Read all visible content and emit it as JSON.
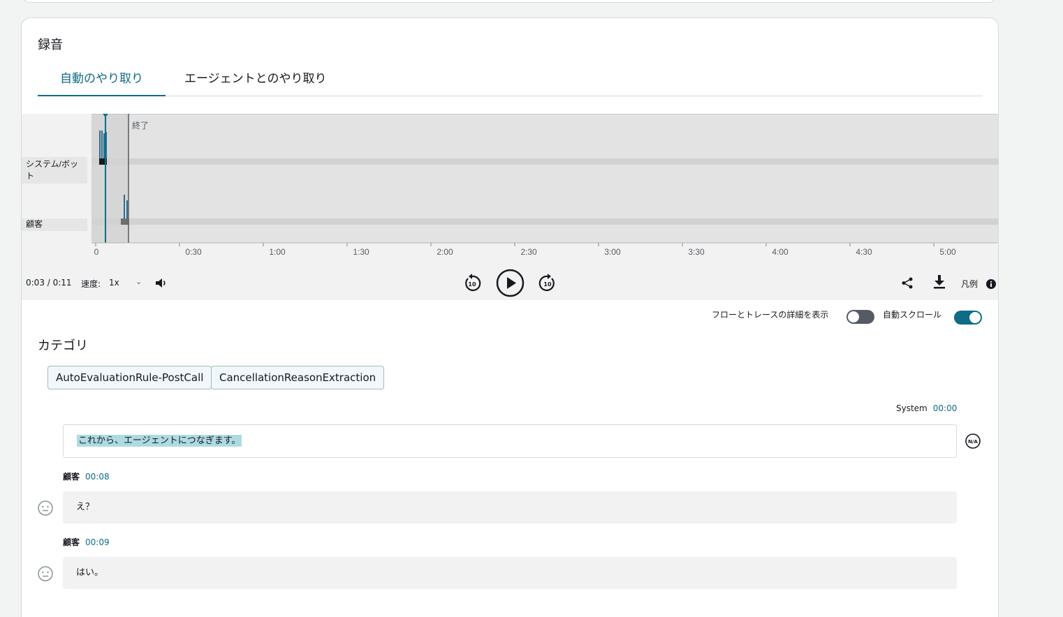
{
  "card": {
    "title": "録音"
  },
  "tabs": [
    {
      "label": "自動のやり取り",
      "active": true
    },
    {
      "label": "エージェントとのやり取り",
      "active": false
    }
  ],
  "timeline": {
    "end_label": "終了",
    "lanes": [
      "システム/ボット",
      "顧客"
    ],
    "ticks": [
      "0",
      "0:30",
      "1:00",
      "1:30",
      "2:00",
      "2:30",
      "3:00",
      "3:30",
      "4:00",
      "4:30",
      "5:00"
    ],
    "accent_color": "#0f6b87"
  },
  "player": {
    "time": "0:03 / 0:11",
    "speed_label": "速度:",
    "speed_value": "1x",
    "legend_label": "凡例",
    "icons": [
      "volume-icon",
      "rewind-10-icon",
      "play-icon",
      "forward-10-icon",
      "share-icon",
      "download-icon",
      "info-icon"
    ]
  },
  "toggles": {
    "flow_trace_label": "フローとトレースの詳細を表示",
    "flow_trace_on": false,
    "autoscroll_label": "自動スクロール",
    "autoscroll_on": true
  },
  "categories": {
    "title": "カテゴリ",
    "items": [
      "AutoEvaluationRule-PostCall",
      "CancellationReasonExtraction"
    ]
  },
  "transcript": [
    {
      "speaker": "System",
      "time": "00:00",
      "text": "これから、エージェントにつなぎます。",
      "badge": "N/A"
    },
    {
      "speaker": "顧客",
      "time": "00:08",
      "text": "え？",
      "sentiment": "neutral"
    },
    {
      "speaker": "顧客",
      "time": "00:09",
      "text": "はい。",
      "sentiment": "neutral"
    }
  ]
}
